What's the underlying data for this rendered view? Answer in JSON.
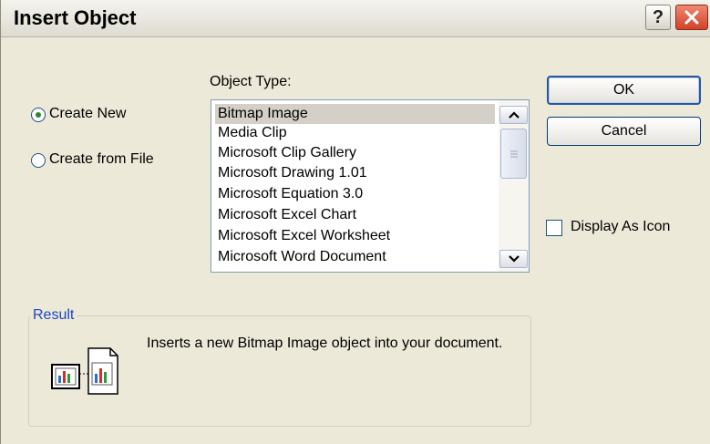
{
  "window": {
    "title": "Insert Object"
  },
  "title_buttons": {
    "help": "?",
    "close": "close"
  },
  "options": {
    "create_new": "Create New",
    "create_from_file": "Create from File",
    "selected": "Create New"
  },
  "object_type": {
    "label": "Object Type:",
    "items": [
      "Bitmap Image",
      "Media Clip",
      "Microsoft Clip Gallery",
      "Microsoft Drawing 1.01",
      "Microsoft Equation 3.0",
      "Microsoft Excel Chart",
      "Microsoft Excel Worksheet",
      "Microsoft Word Document"
    ],
    "selected": "Bitmap Image"
  },
  "buttons": {
    "ok": "OK",
    "cancel": "Cancel"
  },
  "display_as_icon": {
    "label": "Display As Icon",
    "checked": false
  },
  "result": {
    "title": "Result",
    "text": "Inserts a new Bitmap Image object into your document."
  },
  "colors": {
    "dialog_bg": "#ece9d8",
    "close_red": "#d0432a",
    "group_title_blue": "#1c48c4",
    "radio_dot_green": "#2a8a2a"
  },
  "icons": [
    "help-icon",
    "close-icon",
    "scroll-up-arrow-icon",
    "scroll-down-arrow-icon",
    "result-object-icon"
  ]
}
